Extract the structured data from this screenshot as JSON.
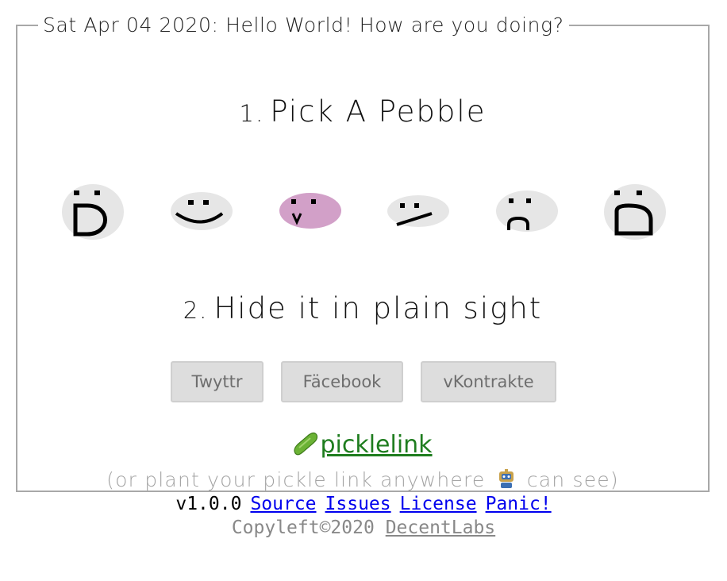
{
  "legend": "Sat Apr 04 2020: Hello World! How are you doing?",
  "steps": [
    {
      "num": "1.",
      "text": "Pick A Pebble"
    },
    {
      "num": "2.",
      "text": "Hide it in plain sight"
    }
  ],
  "pebbles": [
    {
      "name": "laughing",
      "selected": false
    },
    {
      "name": "smiling",
      "selected": false
    },
    {
      "name": "smug",
      "selected": true
    },
    {
      "name": "skeptical",
      "selected": false
    },
    {
      "name": "sad",
      "selected": false
    },
    {
      "name": "shocked",
      "selected": false
    }
  ],
  "colors": {
    "pebble": "#e6e6e6",
    "pebble_selected": "#d2a0c8",
    "pickle_link": "#1f7d1f",
    "link": "#0000ee"
  },
  "share": [
    {
      "id": "twyttr",
      "label": "Twyttr"
    },
    {
      "id": "facebook",
      "label": "Fäcebook"
    },
    {
      "id": "vkontrakte",
      "label": "vKontrakte"
    }
  ],
  "pickle_link": "picklelink",
  "plant": {
    "before": "(or plant your pickle link anywhere",
    "after": "can see)"
  },
  "footer": {
    "version": "v1.0.0",
    "links": [
      "Source",
      "Issues",
      "License",
      "Panic!"
    ],
    "copyleft": "Copyleft©2020",
    "company": "DecentLabs"
  }
}
